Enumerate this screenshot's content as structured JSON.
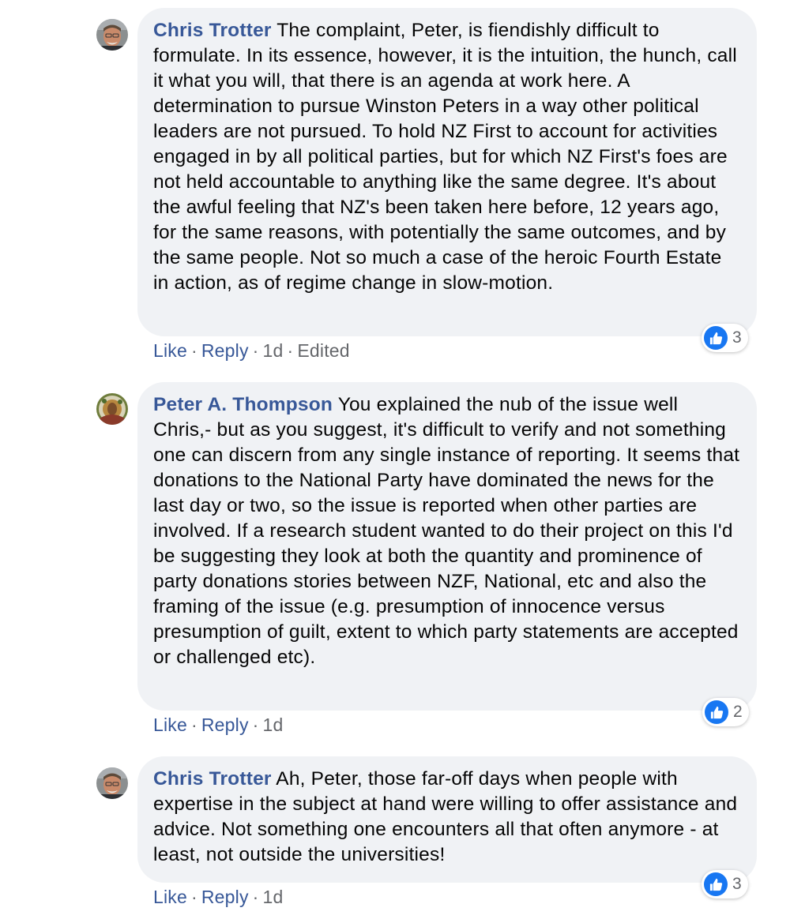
{
  "comments": [
    {
      "author": "Chris Trotter",
      "avatar": "avatar-chris-trotter",
      "text": "The complaint, Peter, is fiendishly difficult to formulate. In its essence, however, it is the intuition, the hunch, call it what you will, that there is an agenda at work here. A determination to pursue Winston Peters in a way other political leaders are not pursued. To hold NZ First to account for activities engaged in by all political parties, but for which NZ First's foes are not held accountable to anything like the same degree. It's about the awful feeling that NZ's been taken here before, 12 years ago, for the same reasons, with potentially the same outcomes, and by the same people. Not so much a case of the heroic Fourth Estate in action, as of regime change in slow-motion.",
      "reaction_icon": "thumbs-up-icon",
      "reaction_count": "3",
      "like_label": "Like",
      "reply_label": "Reply",
      "time": "1d",
      "edited": "Edited"
    },
    {
      "author": "Peter A. Thompson",
      "avatar": "avatar-peter-thompson",
      "text": "You explained the nub of the issue well Chris,- but as you suggest, it's difficult to verify and not something one can discern from any single instance of reporting. It seems that donations to the National Party have dominated the news for the last day or two, so the issue is reported when other parties are involved. If a research student wanted to do their project on this I'd be suggesting they look at both the quantity and prominence of party donations stories between NZF, National, etc and also the framing of the issue (e.g. presumption of innocence versus presumption of guilt, extent to which party statements are accepted or challenged etc).",
      "reaction_icon": "thumbs-up-icon",
      "reaction_count": "2",
      "like_label": "Like",
      "reply_label": "Reply",
      "time": "1d"
    },
    {
      "author": "Chris Trotter",
      "avatar": "avatar-chris-trotter",
      "text": "Ah, Peter, those far-off days when people with expertise in the subject at hand were willing to offer assistance and advice. Not something one encounters all that often anymore - at least, not outside the universities!",
      "reaction_icon": "thumbs-up-icon",
      "reaction_count": "3",
      "like_label": "Like",
      "reply_label": "Reply",
      "time": "1d"
    }
  ],
  "separator": "·",
  "colors": {
    "author": "#385898",
    "bubble": "#f0f2f5",
    "meta": "#65676b",
    "like_badge": "#1877f2"
  }
}
